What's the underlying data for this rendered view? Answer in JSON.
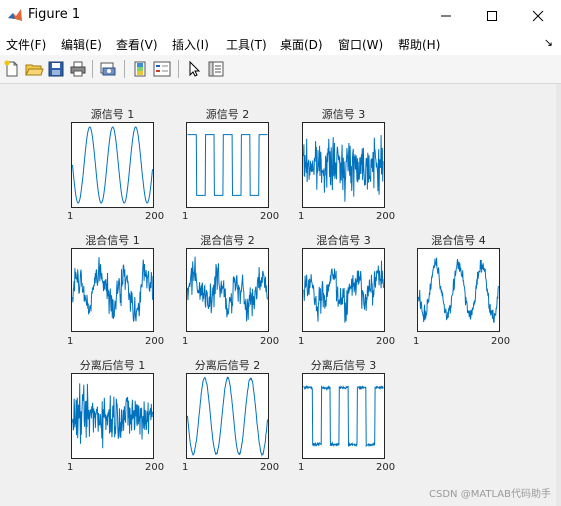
{
  "window": {
    "title": "Figure 1",
    "controls": [
      "minimize",
      "maximize",
      "close"
    ]
  },
  "menu": [
    {
      "label": "文件(F)"
    },
    {
      "label": "编辑(E)"
    },
    {
      "label": "查看(V)"
    },
    {
      "label": "插入(I)"
    },
    {
      "label": "工具(T)"
    },
    {
      "label": "桌面(D)"
    },
    {
      "label": "窗口(W)"
    },
    {
      "label": "帮助(H)"
    }
  ],
  "toolbar": {
    "icons": [
      "new-figure-icon",
      "open-file-icon",
      "save-icon",
      "print-icon",
      "print-preview-icon",
      "colorbar-icon",
      "legend-icon",
      "select-pointer-icon",
      "property-inspector-icon"
    ]
  },
  "colors": {
    "line": "#0072bd",
    "axes_bg": "#ffffff",
    "figure_bg": "#f0f0f0"
  },
  "chart_data": [
    {
      "type": "line",
      "title": "源信号 1",
      "signal": "sine",
      "xlim": [
        1,
        200
      ],
      "xticks": [
        "1",
        "200"
      ],
      "periods": 3.5
    },
    {
      "type": "line",
      "title": "源信号 2",
      "signal": "square",
      "xlim": [
        1,
        200
      ],
      "xticks": [
        "1",
        "200"
      ],
      "periods": 4.5
    },
    {
      "type": "line",
      "title": "源信号 3",
      "signal": "noise",
      "xlim": [
        1,
        200
      ],
      "xticks": [
        "1",
        "200"
      ]
    },
    {
      "type": "line",
      "title": "混合信号 1",
      "signal": "mixed",
      "xlim": [
        1,
        200
      ],
      "xticks": [
        "1",
        "200"
      ]
    },
    {
      "type": "line",
      "title": "混合信号 2",
      "signal": "mixed",
      "xlim": [
        1,
        200
      ],
      "xticks": [
        "1",
        "200"
      ]
    },
    {
      "type": "line",
      "title": "混合信号 3",
      "signal": "mixed",
      "xlim": [
        1,
        200
      ],
      "xticks": [
        "1",
        "200"
      ]
    },
    {
      "type": "line",
      "title": "混合信号 4",
      "signal": "mixed-sine",
      "xlim": [
        1,
        200
      ],
      "xticks": [
        "1",
        "200"
      ]
    },
    {
      "type": "line",
      "title": "分离后信号 1",
      "signal": "noise",
      "xlim": [
        1,
        200
      ],
      "xticks": [
        "1",
        "200"
      ]
    },
    {
      "type": "line",
      "title": "分离后信号 2",
      "signal": "noisy-sine",
      "xlim": [
        1,
        200
      ],
      "xticks": [
        "1",
        "200"
      ],
      "periods": 3.5
    },
    {
      "type": "line",
      "title": "分离后信号 3",
      "signal": "noisy-square",
      "xlim": [
        1,
        200
      ],
      "xticks": [
        "1",
        "200"
      ],
      "periods": 4.5
    }
  ],
  "watermark": "CSDN @MATLAB代码助手"
}
